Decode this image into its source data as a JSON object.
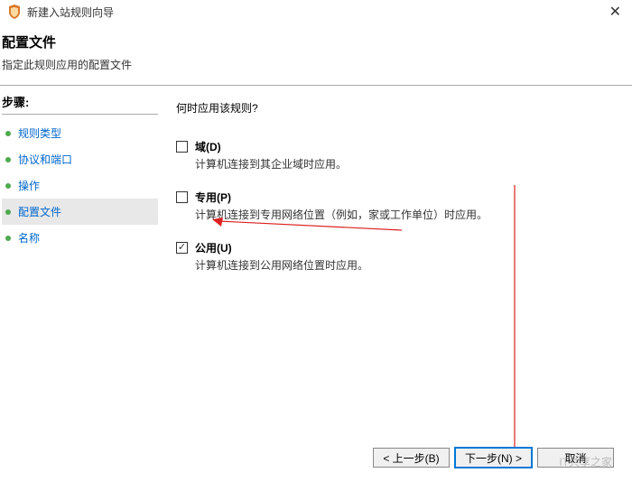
{
  "titlebar": {
    "title": "新建入站规则向导"
  },
  "header": {
    "title": "配置文件",
    "subtitle": "指定此规则应用的配置文件"
  },
  "sidebar": {
    "steps_label": "步骤:",
    "items": [
      {
        "label": "规则类型"
      },
      {
        "label": "协议和端口"
      },
      {
        "label": "操作"
      },
      {
        "label": "配置文件"
      },
      {
        "label": "名称"
      }
    ]
  },
  "main": {
    "question": "何时应用该规则?",
    "options": [
      {
        "label": "域(D)",
        "desc": "计算机连接到其企业域时应用。",
        "checked": false
      },
      {
        "label": "专用(P)",
        "desc": "计算机连接到专用网络位置（例如，家或工作单位）时应用。",
        "checked": false
      },
      {
        "label": "公用(U)",
        "desc": "计算机连接到公用网络位置时应用。",
        "checked": true
      }
    ]
  },
  "footer": {
    "back": "< 上一步(B)",
    "next": "下一步(N) >",
    "cancel": "取消"
  },
  "watermark": "IT共享之家"
}
